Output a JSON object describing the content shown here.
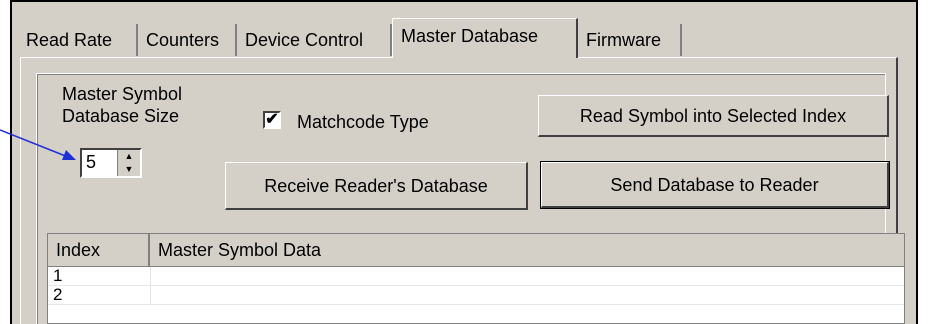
{
  "tabs": [
    "Read Rate",
    "Counters",
    "Device Control",
    "Master Database",
    "Firmware"
  ],
  "active_tab": "Master Database",
  "panel": {
    "size_label_line1": "Master Symbol",
    "size_label_line2": "Database Size",
    "matchcode_label": "Matchcode Type",
    "matchcode_checked": "✔",
    "spinner_value": "5",
    "read_symbol_button": "Read Symbol into Selected Index",
    "receive_button": "Receive Reader's Database",
    "send_button": "Send Database to Reader"
  },
  "table": {
    "columns": [
      "Index",
      "Master Symbol Data"
    ],
    "rows": [
      {
        "index": "1",
        "data": ""
      },
      {
        "index": "2",
        "data": ""
      }
    ]
  },
  "colors": {
    "arrow": "#1f2fd6",
    "face": "#d4d0c8"
  }
}
